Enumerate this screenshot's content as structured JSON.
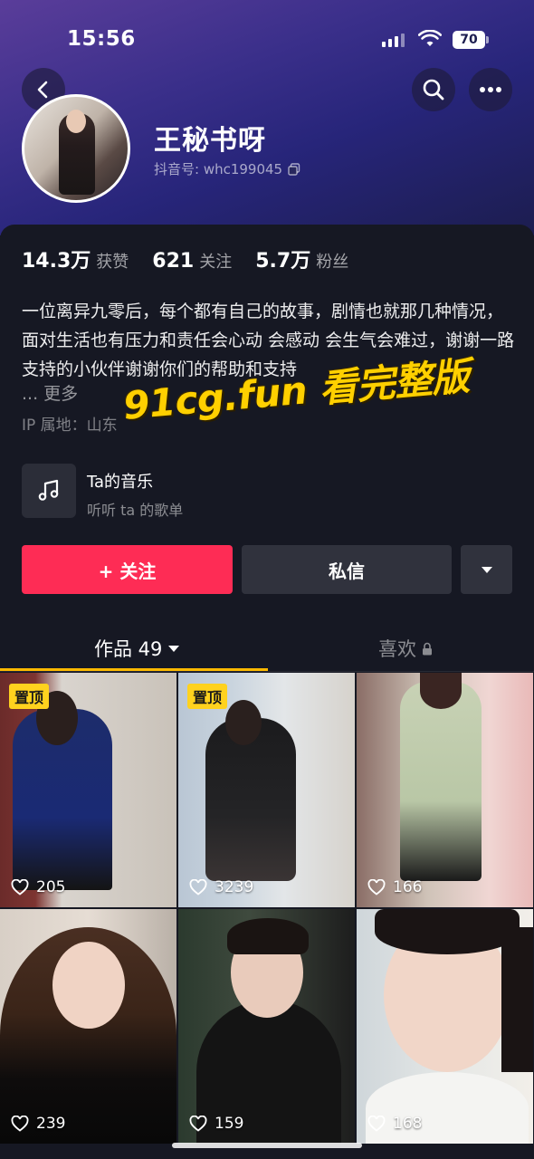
{
  "status_bar": {
    "time": "15:56",
    "battery": "70"
  },
  "profile": {
    "name": "王秘书呀",
    "douyin_id_label": "抖音号: whc199045"
  },
  "stats": [
    {
      "value": "14.3万",
      "label": "获赞"
    },
    {
      "value": "621",
      "label": "关注"
    },
    {
      "value": "5.7万",
      "label": "粉丝"
    }
  ],
  "bio": {
    "text": "一位离异九零后，每个都有自己的故事，剧情也就那几种情况，面对生活也有压力和责任会心动 会感动  会生气会难过，谢谢一路支持的小伙伴谢谢你们的帮助和支持",
    "more": "... 更多",
    "ip": "IP 属地：山东"
  },
  "watermark": "91cg.fun 看完整版",
  "music": {
    "title": "Ta的音乐",
    "subtitle": "听听 ta 的歌单"
  },
  "actions": {
    "follow": "+ 关注",
    "message": "私信"
  },
  "tabs": {
    "works": "作品 49",
    "likes": "喜欢"
  },
  "videos": [
    {
      "likes": "205",
      "pinned": "置顶"
    },
    {
      "likes": "3239",
      "pinned": "置顶"
    },
    {
      "likes": "166",
      "pinned": ""
    },
    {
      "likes": "239",
      "pinned": ""
    },
    {
      "likes": "159",
      "pinned": ""
    },
    {
      "likes": "168",
      "pinned": ""
    }
  ],
  "colors": {
    "accent": "#fe2c55",
    "tab_indicator": "#fcb900",
    "pin_badge": "#ffd21e",
    "background": "#161823"
  }
}
